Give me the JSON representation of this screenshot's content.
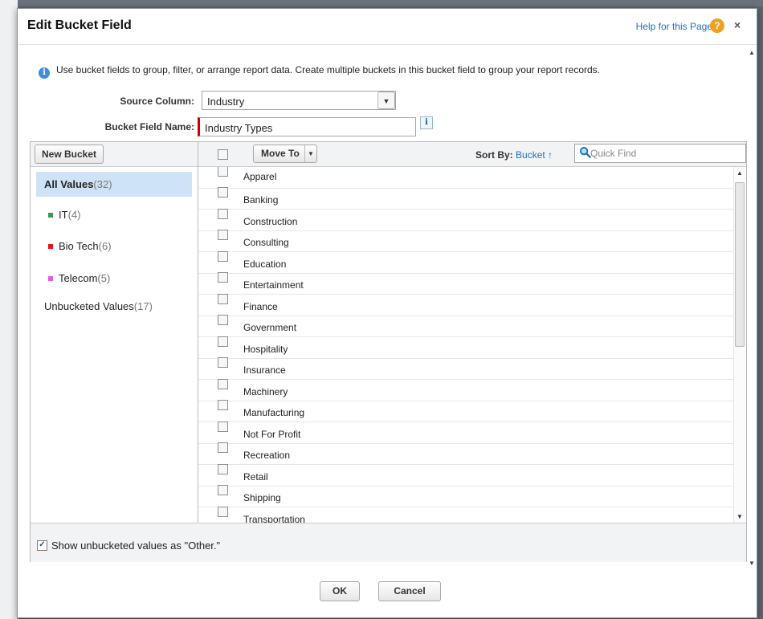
{
  "dialog": {
    "title": "Edit Bucket Field",
    "help_link": "Help for this Page",
    "help_icon_glyph": "?",
    "close_glyph": "×"
  },
  "info": {
    "icon_glyph": "i",
    "text": "Use bucket fields to group, filter, or arrange report data. Create multiple buckets in this bucket field to group your report records."
  },
  "form": {
    "source_column_label": "Source Column:",
    "source_column_value": "Industry",
    "bucket_field_name_label": "Bucket Field Name:",
    "bucket_field_name_value": "Industry Types",
    "info_button_glyph": "i"
  },
  "toolbar": {
    "new_bucket_label": "New Bucket",
    "move_to_label": "Move To",
    "sort_by_label": "Sort By:",
    "sort_by_value": "Bucket",
    "sort_arrow": "↑",
    "quick_find_placeholder": "Quick Find"
  },
  "buckets": [
    {
      "name": "All Values",
      "count": "(32)",
      "color": null,
      "selected": true
    },
    {
      "name": "IT",
      "count": "(4)",
      "color": "#3a9a4a",
      "selected": false
    },
    {
      "name": "Bio Tech",
      "count": "(6)",
      "color": "#e8141c",
      "selected": false
    },
    {
      "name": "Telecom",
      "count": "(5)",
      "color": "#e35be0",
      "selected": false
    },
    {
      "name": "Unbucketed Values",
      "count": "(17)",
      "color": null,
      "selected": false
    }
  ],
  "values": [
    "Apparel",
    "Banking",
    "Construction",
    "Consulting",
    "Education",
    "Entertainment",
    "Finance",
    "Government",
    "Hospitality",
    "Insurance",
    "Machinery",
    "Manufacturing",
    "Not For Profit",
    "Recreation",
    "Retail",
    "Shipping",
    "Transportation"
  ],
  "footer": {
    "show_unbucketed_label": "Show unbucketed values as \"Other.\"",
    "show_unbucketed_checked": true
  },
  "actions": {
    "ok_label": "OK",
    "cancel_label": "Cancel"
  },
  "colors": {
    "accent_link": "#1a70c4",
    "selected_bucket_bg": "#cfe3f6",
    "required_marker": "#cc0000",
    "help_icon": "#f0a020"
  }
}
